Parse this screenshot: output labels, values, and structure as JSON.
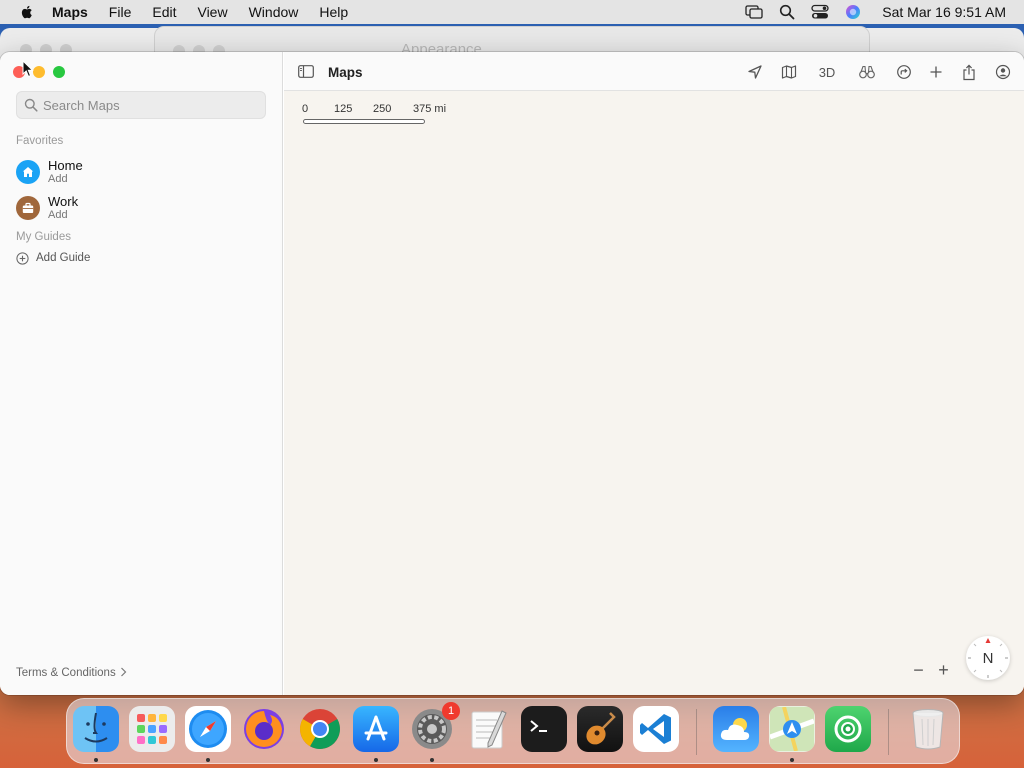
{
  "menubar": {
    "app_name": "Maps",
    "items": [
      "File",
      "Edit",
      "View",
      "Window",
      "Help"
    ],
    "clock": "Sat Mar 16  9:51 AM",
    "status_icons": [
      "screen-mirroring-icon",
      "spotlight-search-icon",
      "control-center-icon",
      "siri-icon"
    ]
  },
  "background_window": {
    "title": "Appearance"
  },
  "sidebar": {
    "search_placeholder": "Search Maps",
    "favorites_label": "Favorites",
    "favorites": [
      {
        "name": "Home",
        "sub": "Add",
        "icon": "home-icon",
        "color": "#1aa3f5"
      },
      {
        "name": "Work",
        "sub": "Add",
        "icon": "briefcase-icon",
        "color": "#a0673b"
      }
    ],
    "guides_label": "My Guides",
    "add_guide": "Add Guide",
    "terms": "Terms & Conditions"
  },
  "toolbar": {
    "title": "Maps",
    "three_d": "3D",
    "buttons": [
      "location-arrow-icon",
      "map-mode-icon",
      "3d-button",
      "look-around-icon",
      "directions-icon",
      "add-icon",
      "share-icon",
      "account-icon"
    ]
  },
  "map": {
    "scale_labels": [
      "0",
      "125",
      "250",
      "375 mi"
    ],
    "zoom_out": "−",
    "zoom_in": "+",
    "compass": "N"
  },
  "dock": {
    "apps": [
      "Finder",
      "Launchpad",
      "Safari",
      "Firefox",
      "Chrome",
      "App Store",
      "System Preferences",
      "TextEdit",
      "Terminal",
      "GarageBand",
      "VS Code",
      "Weather",
      "Maps",
      "Find My",
      "Trash"
    ],
    "settings_badge": "1"
  },
  "colors": {
    "accent_blue": "#1aa3f5",
    "close": "#fe5f57",
    "minimize": "#febc2e",
    "maximize": "#28c840",
    "map_background": "#f7f4ef"
  }
}
